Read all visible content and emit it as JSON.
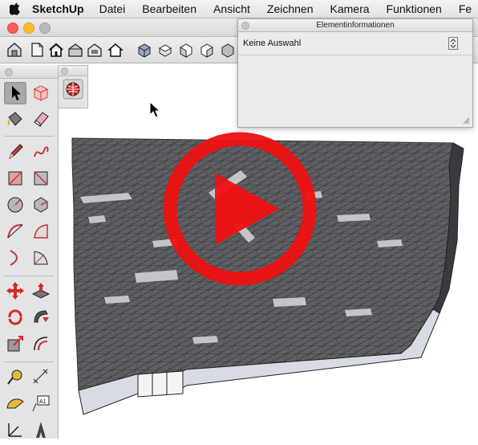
{
  "menubar": {
    "app_name": "SketchUp",
    "items": [
      "Datei",
      "Bearbeiten",
      "Ansicht",
      "Zeichnen",
      "Kamera",
      "Funktionen",
      "Fe"
    ]
  },
  "entity_info": {
    "title": "Elementinformationen",
    "selection": "Keine Auswahl"
  },
  "palette_text": {
    "text_tool": "A1"
  },
  "colors": {
    "play_red": "#ee1111",
    "terrain_gray": "#5e6064",
    "terrain_side": "#d9dbe4"
  },
  "icons": {
    "toolbar": [
      "house-front-icon",
      "page-icon",
      "home-icon",
      "roof-icon",
      "camera-icon",
      "house-outline-icon",
      "iso-view-icon",
      "top-view-icon",
      "front-view-icon",
      "right-view-icon",
      "back-view-icon"
    ],
    "palette": [
      "select-arrow-icon",
      "component-icon",
      "paint-bucket-icon",
      "eraser-icon",
      "pencil-icon",
      "freehand-icon",
      "rectangle-icon",
      "rotated-rect-icon",
      "circle-icon",
      "polygon-icon",
      "arc-icon",
      "pie-arc-icon",
      "two-point-arc-icon",
      "three-point-arc-icon",
      "move-icon",
      "push-pull-icon",
      "rotate-icon",
      "follow-me-icon",
      "scale-icon",
      "offset-icon",
      "tape-measure-icon",
      "dimension-icon",
      "protractor-icon",
      "text-icon",
      "axes-icon",
      "3d-text-icon"
    ]
  }
}
